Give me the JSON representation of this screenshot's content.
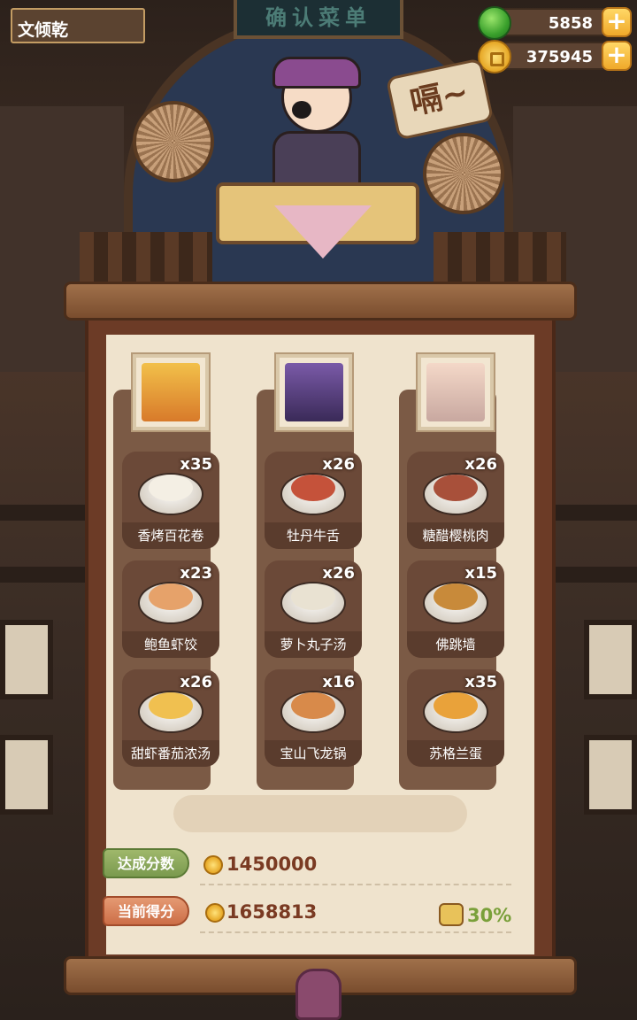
{
  "player": {
    "name": "文倾乾"
  },
  "sign": {
    "text": "确认菜单"
  },
  "currencies": [
    {
      "icon": "jade-icon",
      "value": "5858"
    },
    {
      "icon": "coin-icon",
      "value": "375945"
    }
  ],
  "speech": {
    "text": "嗝~"
  },
  "plus_label": "+",
  "columns": [
    {
      "portrait": "guest-portrait-1",
      "dishes": [
        {
          "name": "香烤百花卷",
          "qty": "x35",
          "color": "#f4efe4"
        },
        {
          "name": "鲍鱼虾饺",
          "qty": "x23",
          "color": "#e6a26a"
        },
        {
          "name": "甜虾番茄浓汤",
          "qty": "x26",
          "color": "#f0c050"
        }
      ]
    },
    {
      "portrait": "guest-portrait-2",
      "dishes": [
        {
          "name": "牡丹牛舌",
          "qty": "x26",
          "color": "#c5523a"
        },
        {
          "name": "萝卜丸子汤",
          "qty": "x26",
          "color": "#e9e2d2"
        },
        {
          "name": "宝山飞龙锅",
          "qty": "x16",
          "color": "#d88a4a"
        }
      ]
    },
    {
      "portrait": "guest-portrait-3",
      "dishes": [
        {
          "name": "糖醋樱桃肉",
          "qty": "x26",
          "color": "#a8503a"
        },
        {
          "name": "佛跳墙",
          "qty": "x15",
          "color": "#c88a3a"
        },
        {
          "name": "苏格兰蛋",
          "qty": "x35",
          "color": "#e9a23a"
        }
      ]
    }
  ],
  "score": {
    "target_label": "达成分数",
    "target_value": "1450000",
    "current_label": "当前得分",
    "current_value": "1658813",
    "percent": "30%"
  }
}
